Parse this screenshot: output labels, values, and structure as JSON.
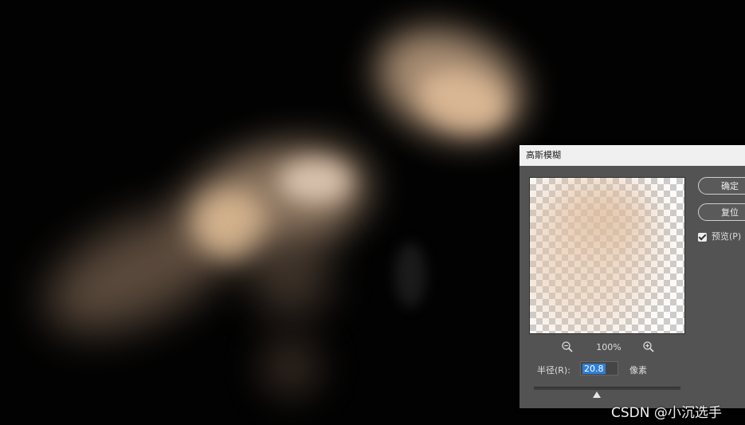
{
  "dialog": {
    "title": "高斯模糊",
    "zoom_level": "100%",
    "radius": {
      "label": "半径(R):",
      "value": "20.8",
      "unit": "像素"
    },
    "ok_button": "确定",
    "reset_button": "复位",
    "preview_checkbox": {
      "label": "预览(P)",
      "checked": true
    },
    "slider": {
      "value": 0.5
    }
  },
  "watermark": "CSDN @小沉选手",
  "icons": [
    "zoom-out-icon",
    "zoom-in-icon",
    "checkmark-icon",
    "slider-thumb-icon"
  ],
  "colors": {
    "canvas_bg": "#020202",
    "dialog_bg": "#535353",
    "titlebar_bg": "#f0f0f0",
    "input_highlight": "#2f7fd7"
  }
}
